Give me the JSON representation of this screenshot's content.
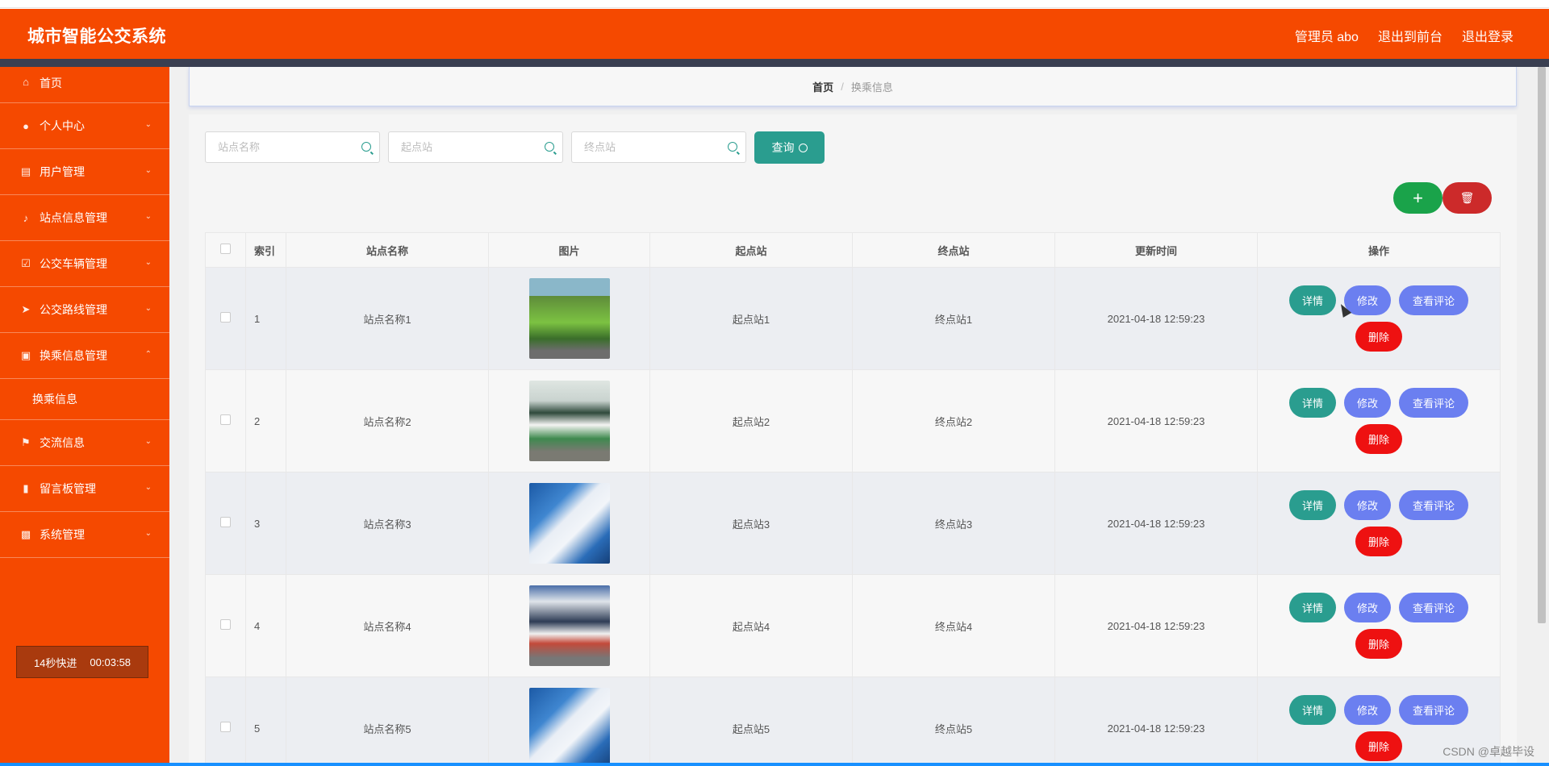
{
  "header": {
    "title": "城市智能公交系统",
    "user": "管理员 abo",
    "to_front": "退出到前台",
    "logout": "退出登录"
  },
  "sidebar": {
    "items": [
      {
        "label": "首页",
        "icon": "home-icon"
      },
      {
        "label": "个人中心",
        "icon": "user-icon"
      },
      {
        "label": "用户管理",
        "icon": "clipboard-icon"
      },
      {
        "label": "站点信息管理",
        "icon": "microphone-icon"
      },
      {
        "label": "公交车辆管理",
        "icon": "checkbox-icon"
      },
      {
        "label": "公交路线管理",
        "icon": "send-icon"
      },
      {
        "label": "换乘信息管理",
        "icon": "monitor-icon"
      },
      {
        "label": "交流信息",
        "icon": "flag-icon"
      },
      {
        "label": "留言板管理",
        "icon": "briefcase-icon"
      },
      {
        "label": "系统管理",
        "icon": "chat-icon"
      }
    ],
    "submenu": "换乘信息",
    "timer_label": "14秒快进",
    "timer_time": "00:03:58"
  },
  "breadcrumb": {
    "home": "首页",
    "separator": "/",
    "current": "换乘信息"
  },
  "search": {
    "station_placeholder": "站点名称",
    "start_placeholder": "起点站",
    "end_placeholder": "终点站",
    "query_label": "查询"
  },
  "table": {
    "headers": [
      "索引",
      "站点名称",
      "图片",
      "起点站",
      "终点站",
      "更新时间",
      "操作"
    ],
    "rows": [
      {
        "index": "1",
        "station": "站点名称1",
        "start": "起点站1",
        "end": "终点站1",
        "time": "2021-04-18 12:59:23"
      },
      {
        "index": "2",
        "station": "站点名称2",
        "start": "起点站2",
        "end": "终点站2",
        "time": "2021-04-18 12:59:23"
      },
      {
        "index": "3",
        "station": "站点名称3",
        "start": "起点站3",
        "end": "终点站3",
        "time": "2021-04-18 12:59:23"
      },
      {
        "index": "4",
        "station": "站点名称4",
        "start": "起点站4",
        "end": "终点站4",
        "time": "2021-04-18 12:59:23"
      },
      {
        "index": "5",
        "station": "站点名称5",
        "start": "起点站5",
        "end": "终点站5",
        "time": "2021-04-18 12:59:23"
      }
    ],
    "actions": {
      "detail": "详情",
      "edit": "修改",
      "review": "查看评论",
      "delete": "删除"
    }
  },
  "watermark": "CSDN @卓越毕设",
  "colors": {
    "accent": "#f54900",
    "teal": "#2a9d8f",
    "indigo": "#6b7ff0",
    "danger": "#ee1111",
    "green": "#1aa34a"
  }
}
